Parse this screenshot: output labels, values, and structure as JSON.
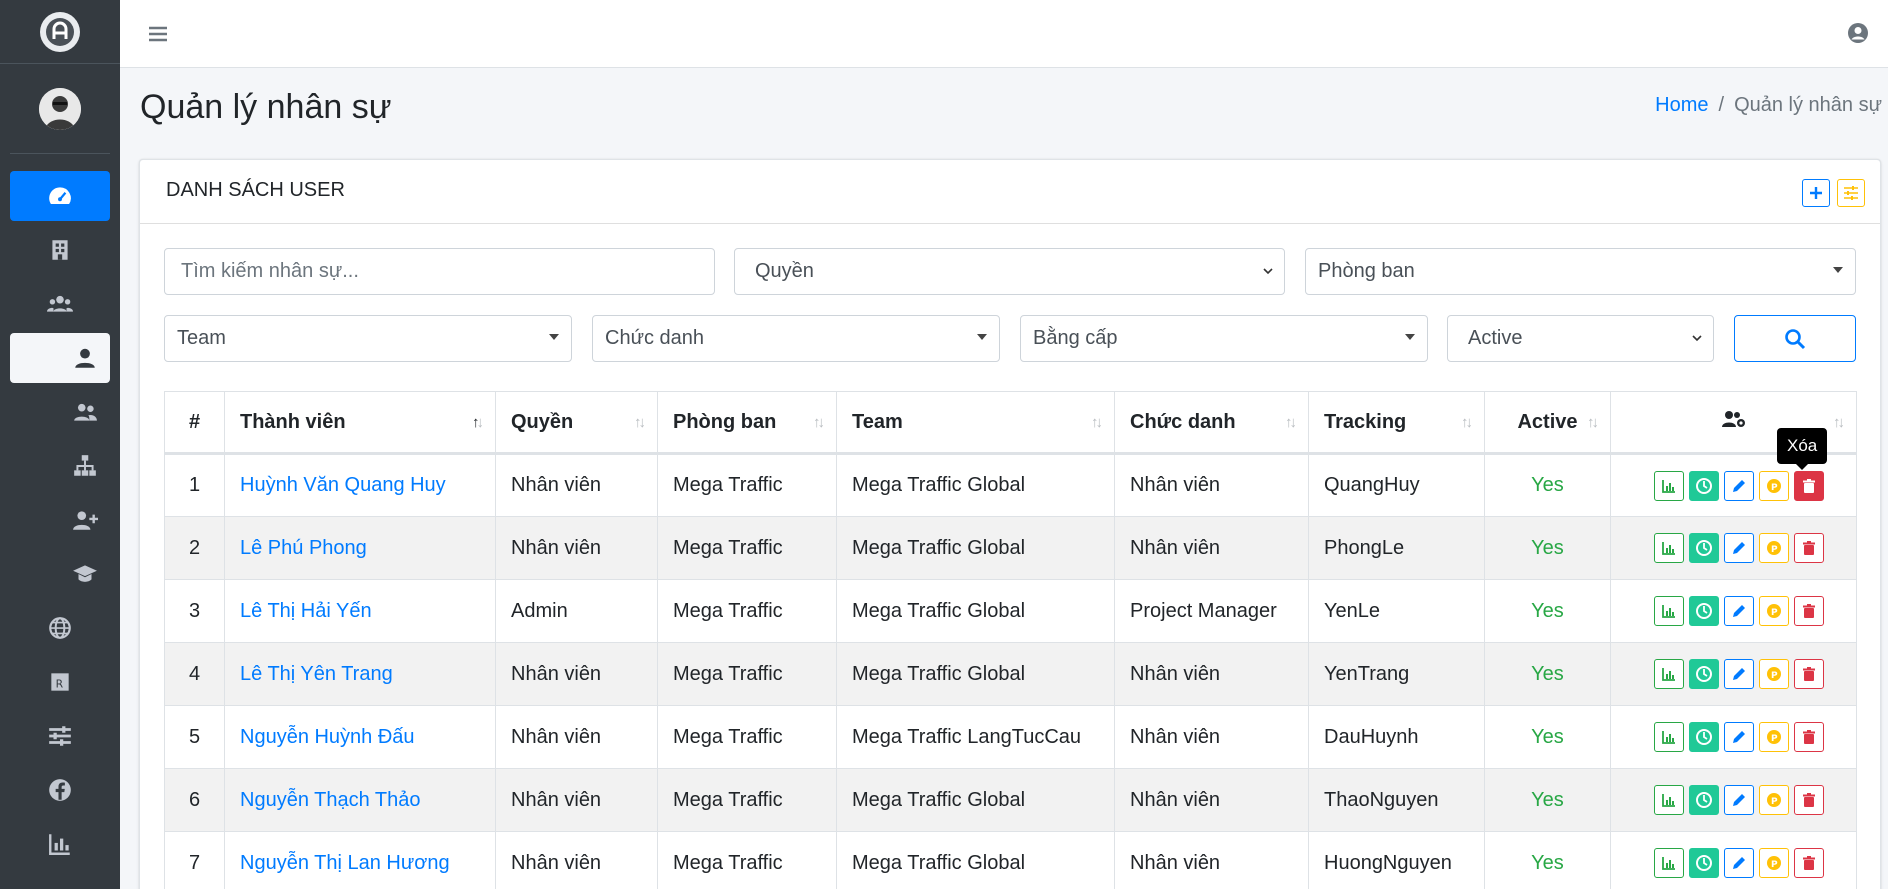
{
  "header": {
    "page_title": "Quản lý nhân sự",
    "breadcrumb": {
      "home": "Home",
      "current": "Quản lý nhân sự"
    }
  },
  "card": {
    "title": "DANH SÁCH USER"
  },
  "filters": {
    "search_placeholder": "Tìm kiếm nhân sự...",
    "role": "Quyền",
    "department": "Phòng ban",
    "team": "Team",
    "position": "Chức danh",
    "degree": "Bằng cấp",
    "active": "Active"
  },
  "table": {
    "columns": [
      "#",
      "Thành viên",
      "Quyền",
      "Phòng ban",
      "Team",
      "Chức danh",
      "Tracking",
      "Active"
    ],
    "rows": [
      {
        "no": "1",
        "name": "Huỳnh Văn Quang Huy",
        "role": "Nhân viên",
        "dept": "Mega Traffic",
        "team": "Mega Traffic Global",
        "title": "Nhân viên",
        "tracking": "QuangHuy",
        "active": "Yes"
      },
      {
        "no": "2",
        "name": "Lê Phú Phong",
        "role": "Nhân viên",
        "dept": "Mega Traffic",
        "team": "Mega Traffic Global",
        "title": "Nhân viên",
        "tracking": "PhongLe",
        "active": "Yes"
      },
      {
        "no": "3",
        "name": "Lê Thị Hải Yến",
        "role": "Admin",
        "dept": "Mega Traffic",
        "team": "Mega Traffic Global",
        "title": "Project Manager",
        "tracking": "YenLe",
        "active": "Yes"
      },
      {
        "no": "4",
        "name": "Lê Thị Yên Trang",
        "role": "Nhân viên",
        "dept": "Mega Traffic",
        "team": "Mega Traffic Global",
        "title": "Nhân viên",
        "tracking": "YenTrang",
        "active": "Yes"
      },
      {
        "no": "5",
        "name": "Nguyễn Huỳnh Đấu",
        "role": "Nhân viên",
        "dept": "Mega Traffic",
        "team": "Mega Traffic LangTucCau",
        "title": "Nhân viên",
        "tracking": "DauHuynh",
        "active": "Yes"
      },
      {
        "no": "6",
        "name": "Nguyễn Thạch Thảo",
        "role": "Nhân viên",
        "dept": "Mega Traffic",
        "team": "Mega Traffic Global",
        "title": "Nhân viên",
        "tracking": "ThaoNguyen",
        "active": "Yes"
      },
      {
        "no": "7",
        "name": "Nguyễn Thị Lan Hương",
        "role": "Nhân viên",
        "dept": "Mega Traffic",
        "team": "Mega Traffic Global",
        "title": "Nhân viên",
        "tracking": "HuongNguyen",
        "active": "Yes"
      }
    ]
  },
  "tooltip": "Xóa",
  "colors": {
    "sidebar": "#343a40",
    "primary": "#007bff",
    "success": "#28a745",
    "teal": "#20c997",
    "warning": "#ffc107",
    "danger": "#dc3545"
  },
  "icons": {
    "sidebar": [
      "dashboard-icon",
      "building-icon",
      "users-icon",
      "user-icon",
      "user-friends-icon",
      "sitemap-icon",
      "user-plus-icon",
      "graduation-cap-icon",
      "globe-icon",
      "registered-icon",
      "sliders-icon",
      "facebook-icon",
      "chart-bar-icon"
    ],
    "row_actions": [
      "chart-icon",
      "clock-icon",
      "edit-icon",
      "coin-icon",
      "trash-icon"
    ]
  }
}
